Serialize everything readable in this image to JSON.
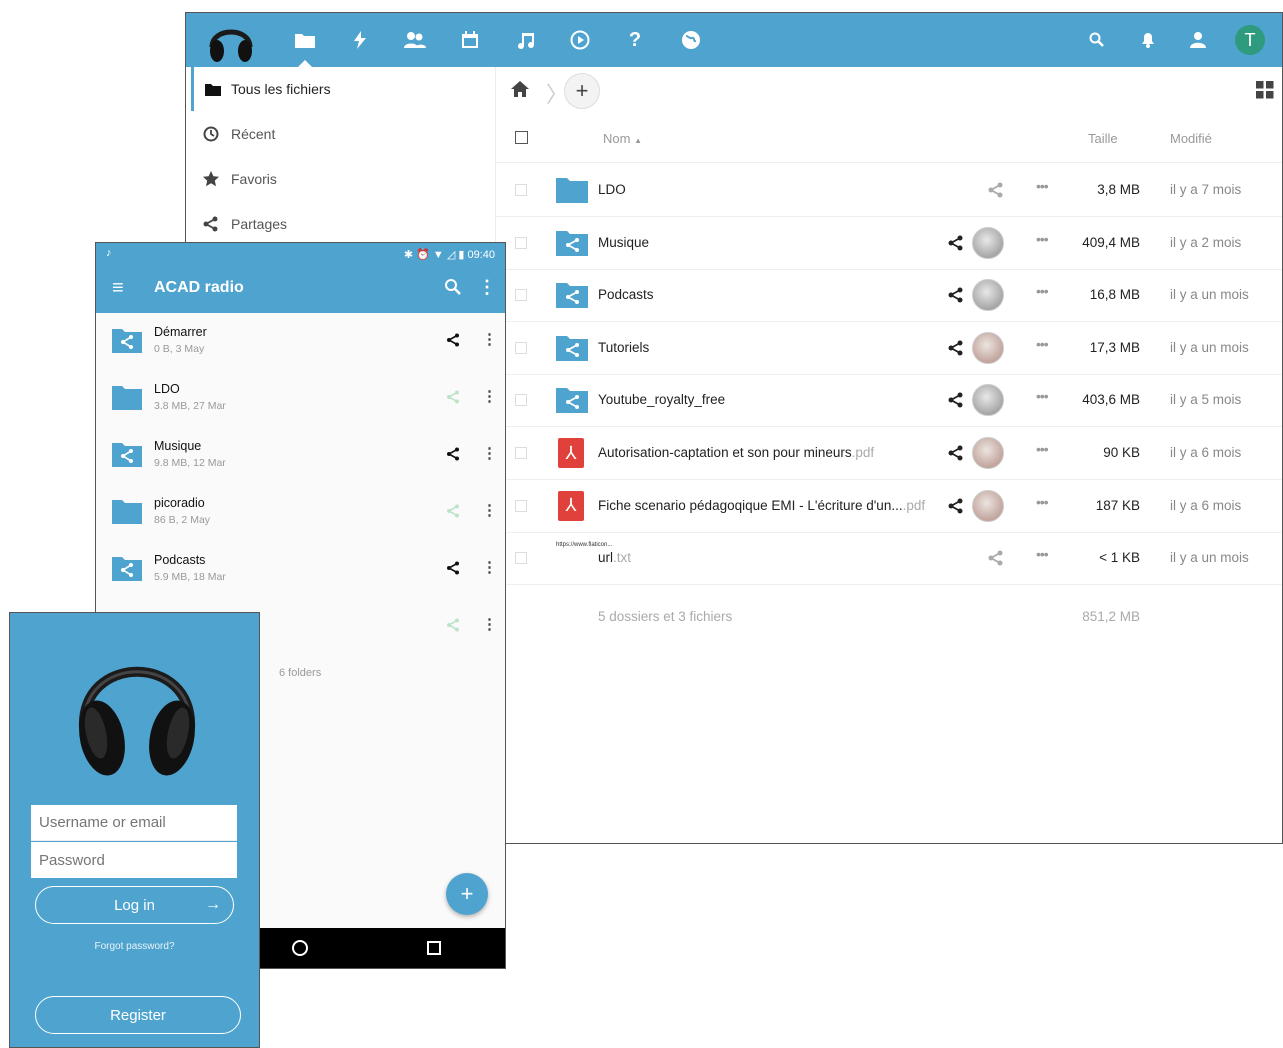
{
  "desktop": {
    "nav": [
      {
        "label": "Tous les fichiers",
        "icon": "folder-icon"
      },
      {
        "label": "Récent",
        "icon": "clock-icon"
      },
      {
        "label": "Favoris",
        "icon": "star-icon"
      },
      {
        "label": "Partages",
        "icon": "share-icon"
      }
    ],
    "avatar_letter": "T",
    "table": {
      "col_name": "Nom",
      "col_size": "Taille",
      "col_modified": "Modifié"
    },
    "files": [
      {
        "name": "LDO",
        "ext": "",
        "size": "3,8 MB",
        "modified": "il y a 7 mois",
        "type": "folder",
        "shared": false
      },
      {
        "name": "Musique",
        "ext": "",
        "size": "409,4 MB",
        "modified": "il y a 2 mois",
        "type": "shared-folder",
        "shared": true
      },
      {
        "name": "Podcasts",
        "ext": "",
        "size": "16,8 MB",
        "modified": "il y a un mois",
        "type": "shared-folder",
        "shared": true
      },
      {
        "name": "Tutoriels",
        "ext": "",
        "size": "17,3 MB",
        "modified": "il y a un mois",
        "type": "shared-folder",
        "shared": true
      },
      {
        "name": "Youtube_royalty_free",
        "ext": "",
        "size": "403,6 MB",
        "modified": "il y a 5 mois",
        "type": "shared-folder",
        "shared": true
      },
      {
        "name": "Autorisation-captation et son pour mineurs",
        "ext": ".pdf",
        "size": "90 KB",
        "modified": "il y a 6 mois",
        "type": "pdf",
        "shared": true
      },
      {
        "name": "Fiche scenario pédagoqique EMI - L'écriture d'un...",
        "ext": ".pdf",
        "size": "187 KB",
        "modified": "il y a 6 mois",
        "type": "pdf",
        "shared": true
      },
      {
        "name": "url",
        "ext": ".txt",
        "size": "< 1 KB",
        "modified": "il y a un mois",
        "type": "txt",
        "shared": false
      }
    ],
    "summary": {
      "count": "5 dossiers et 3 fichiers",
      "total": "851,2 MB"
    },
    "txt_thumb": "https://www.flaticon..."
  },
  "mobile": {
    "status_time": "09:40",
    "title": "ACAD radio",
    "items": [
      {
        "name": "Démarrer",
        "meta": "0 B, 3 May",
        "shared": true
      },
      {
        "name": "LDO",
        "meta": "3.8 MB, 27 Mar",
        "shared": false
      },
      {
        "name": "Musique",
        "meta": "9.8 MB, 12 Mar",
        "shared": true
      },
      {
        "name": "picoradio",
        "meta": "86 B, 2 May",
        "shared": false
      },
      {
        "name": "Podcasts",
        "meta": "5.9 MB, 18 Mar",
        "shared": true
      }
    ],
    "folders_count": "6 folders",
    "fab": "+"
  },
  "login": {
    "username_placeholder": "Username or email",
    "password_placeholder": "Password",
    "login_label": "Log in",
    "forgot_label": "Forgot password?",
    "register_label": "Register"
  },
  "colors": {
    "brand": "#4fa4cf",
    "avatar": "#2e9a7e",
    "pdf": "#e0413a"
  }
}
